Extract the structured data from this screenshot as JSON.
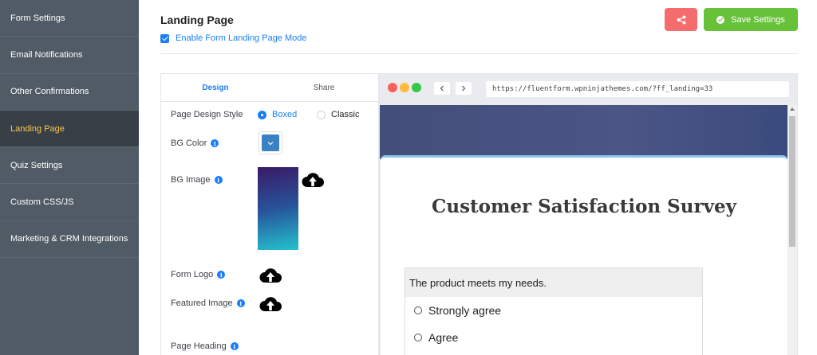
{
  "sidebar": {
    "items": [
      {
        "label": "Form Settings"
      },
      {
        "label": "Email Notifications"
      },
      {
        "label": "Other Confirmations"
      },
      {
        "label": "Landing Page"
      },
      {
        "label": "Quiz Settings"
      },
      {
        "label": "Custom CSS/JS"
      },
      {
        "label": "Marketing & CRM Integrations"
      }
    ],
    "active_index": 3
  },
  "header": {
    "title": "Landing Page",
    "enable_label": "Enable Form Landing Page Mode",
    "enable_checked": true,
    "share_icon": "share-icon",
    "save_label": "Save Settings"
  },
  "settings": {
    "tabs": [
      {
        "label": "Design"
      },
      {
        "label": "Share"
      }
    ],
    "active_tab": "Design",
    "design_style_label": "Page Design Style",
    "style_options": [
      {
        "label": "Boxed",
        "selected": true
      },
      {
        "label": "Classic",
        "selected": false
      }
    ],
    "bg_color_label": "BG Color",
    "bg_color_value": "#3a82c4",
    "bg_image_label": "BG Image",
    "form_logo_label": "Form Logo",
    "featured_image_label": "Featured Image",
    "page_heading_label": "Page Heading"
  },
  "preview": {
    "url": "https://fluentform.wpninjathemes.com/?ff_landing=33",
    "survey_title": "Customer Satisfaction Survey",
    "question": "The product meets my needs.",
    "choices": [
      {
        "label": "Strongly agree"
      },
      {
        "label": "Agree"
      }
    ]
  },
  "colors": {
    "accent": "#1a7efb",
    "sidebar_bg": "#515b66",
    "sidebar_active_bg": "#393f47",
    "sidebar_active_text": "#f7c64b",
    "save_button": "#67c23a",
    "share_button": "#f56c6c"
  }
}
